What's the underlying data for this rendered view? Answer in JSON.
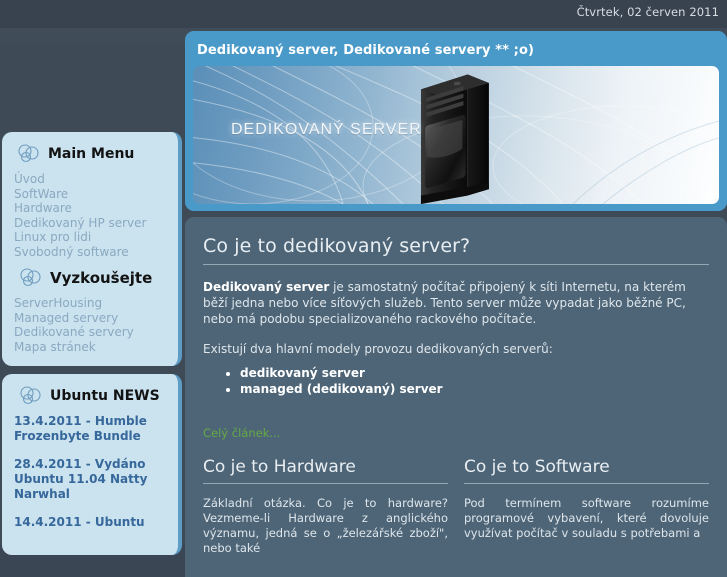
{
  "topbar": {
    "date": "Čtvrtek, 02 červen 2011"
  },
  "banner": {
    "title": "Dedikovaný server, Dedikované servery ** ;o)",
    "image_label": "DEDIKOVANÝ SERVER",
    "image_alt": "server-tower-photo"
  },
  "sidebar": {
    "modules": [
      {
        "title": "Main Menu",
        "icon": "three-circles-icon",
        "items": [
          {
            "label": "Úvod"
          },
          {
            "label": "SoftWare"
          },
          {
            "label": "Hardware"
          },
          {
            "label": "Dedikovaný HP server"
          },
          {
            "label": "Linux pro lidi"
          },
          {
            "label": "Svobodný software"
          }
        ]
      },
      {
        "title": "Vyzkoušejte",
        "icon": "three-circles-icon",
        "items": [
          {
            "label": "ServerHousing"
          },
          {
            "label": "Managed servery"
          },
          {
            "label": "Dedikované servery"
          },
          {
            "label": "Mapa stránek"
          }
        ]
      }
    ],
    "news_module": {
      "title": "Ubuntu NEWS",
      "icon": "three-circles-icon",
      "items": [
        {
          "label": "13.4.2011 - Humble Frozenbyte Bundle"
        },
        {
          "label": "28.4.2011 - Vydáno Ubuntu 11.04 Natty Narwhal"
        },
        {
          "label": "14.4.2011 - Ubuntu"
        }
      ]
    }
  },
  "main": {
    "article": {
      "title": "Co je to dedikovaný server?",
      "lead_bold": "Dedikovaný server",
      "lead_rest": " je samostatný počítač připojený k síti Internetu, na kterém běží jedna nebo více síťových služeb. Tento server může vypadat jako běžné PC, nebo má podobu specializovaného rackového počítače.",
      "intro": "Existují dva hlavní modely provozu dedikovaných serverů:",
      "models": [
        "dedikovaný server",
        "managed (dedikovaný) server"
      ],
      "readmore": "Celý článek..."
    },
    "columns": [
      {
        "title": "Co je to Hardware",
        "text": "Základní otázka. Co je to hardware? Vezmeme-li Hardware z anglického významu, jedná se o „železářské zboží\", nebo také"
      },
      {
        "title": "Co je to Software",
        "text": "Pod termínem software rozumíme programové vybavení, které dovoluje využívat počítač v souladu s potřebami a"
      }
    ]
  },
  "colors": {
    "page_bg": "#3f4a57",
    "topbar_bg": "#39434f",
    "banner_accent": "#4a9ac9",
    "main_panel": "#4d6577",
    "module_bg": "#cbe2ef",
    "module_edge": "#5d9cc4",
    "link_sidebar": "#8aa9c1",
    "link_news": "#37689b",
    "link_readmore": "#66aa44"
  }
}
